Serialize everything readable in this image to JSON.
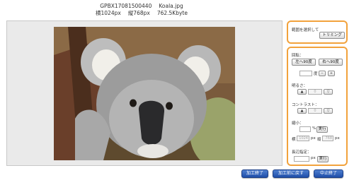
{
  "file": {
    "id": "GPBX17081500440",
    "name": "Koala.jpg",
    "width": "横1024px",
    "height": "縦768px",
    "size": "762.5Kbyte"
  },
  "trim_panel": {
    "label": "範囲を選択して",
    "trim_button": "トリミング"
  },
  "edit_panel": {
    "rotate": {
      "label": "回転：",
      "left_button": "左へ90度",
      "right_button": "右へ90度",
      "unit": "度",
      "minus": "−",
      "plus": "+"
    },
    "brightness": {
      "label": "明るさ：",
      "value": "0",
      "up_icon": "triangle-up-icon",
      "down_icon": "triangle-down-icon"
    },
    "contrast": {
      "label": "コントラスト：",
      "value": "0"
    },
    "shrink": {
      "label": "縮小：",
      "percent_unit": "%",
      "apply_button": "実行",
      "width_label": "横",
      "width_value": "1024",
      "width_unit": "px",
      "height_label": "縦",
      "height_value": "768",
      "height_unit": "px"
    },
    "long_side": {
      "label": "長辺指定：",
      "unit": "px",
      "apply_button": "実行"
    }
  },
  "footer": {
    "finish_button": "加工終了",
    "revert_button": "加工前に戻す",
    "cancel_button": "中止終了"
  },
  "colors": {
    "panel_border": "#f2a23c",
    "footer_button": "#2b5bb8"
  }
}
